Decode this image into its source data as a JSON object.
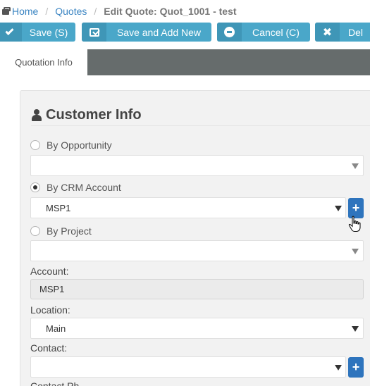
{
  "breadcrumb": {
    "home": "Home",
    "quotes": "Quotes",
    "current": "Edit Quote: Quot_1001 - test"
  },
  "toolbar": {
    "save": "Save (S)",
    "save_add": "Save and Add New",
    "cancel": "Cancel (C)",
    "delete": "Del"
  },
  "tabs": {
    "active": "Quotation Info"
  },
  "customer_info": {
    "title": "Customer Info",
    "by_opportunity": {
      "label": "By Opportunity",
      "selected": false,
      "value": ""
    },
    "by_crm_account": {
      "label": "By CRM Account",
      "selected": true,
      "value": "MSP1"
    },
    "by_project": {
      "label": "By Project",
      "selected": false,
      "value": ""
    },
    "account": {
      "label": "Account:",
      "value": "MSP1"
    },
    "location": {
      "label": "Location:",
      "value": "Main"
    },
    "contact": {
      "label": "Contact:",
      "value": ""
    },
    "next_label_partial": "Contact Ph"
  },
  "icons": {
    "plus": "+"
  },
  "colors": {
    "toolbar_button": "#4aa7c9",
    "plus_button": "#2e74bd",
    "link": "#3a84c2",
    "tab_bar": "#666c6c"
  }
}
